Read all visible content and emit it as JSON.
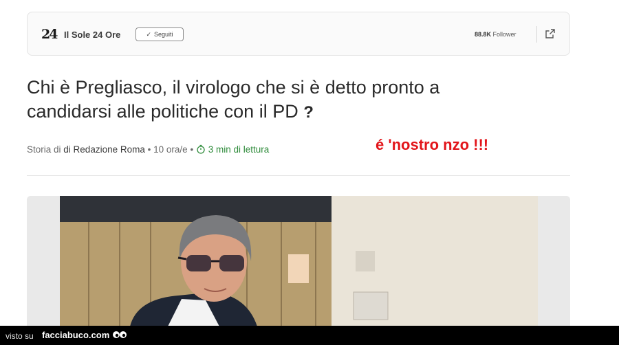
{
  "publisher": {
    "logo_text": "24",
    "name": "Il Sole 24 Ore",
    "follow_label": "Seguiti",
    "followers_count": "88.8K",
    "followers_label": "Follower"
  },
  "article": {
    "headline": "Chi è Pregliasco, il virologo che si è detto pronto a candidarsi alle politiche con il PD",
    "headline_suffix": "?",
    "story_prefix": "Storia di",
    "author": "di Redazione Roma",
    "age": "10 ora/e",
    "read_time": "3 min di lettura"
  },
  "annotation": "é 'nostro nzo !!!",
  "watermark": {
    "visto_su": "visto su",
    "site": "facciabuco.com"
  },
  "colors": {
    "annotation": "#e2151a",
    "read_time": "#2e8b3a",
    "watermark_bg": "#000000"
  }
}
